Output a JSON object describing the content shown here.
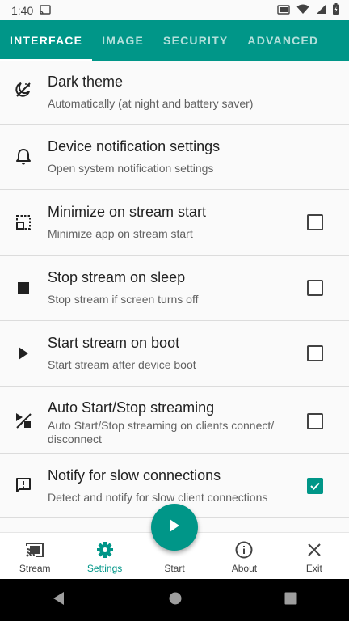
{
  "status_bar": {
    "time": "1:40",
    "icons": [
      "cast-icon",
      "wifi-icon",
      "signal-icon",
      "battery-icon"
    ]
  },
  "tabs": [
    {
      "label": "INTERFACE",
      "active": true
    },
    {
      "label": "IMAGE",
      "active": false
    },
    {
      "label": "SECURITY",
      "active": false
    },
    {
      "label": "ADVANCED",
      "active": false
    }
  ],
  "settings": [
    {
      "title": "Dark theme",
      "subtitle": "Automatically (at night and battery saver)",
      "icon": "dark-theme-icon",
      "has_checkbox": false
    },
    {
      "title": "Device notification settings",
      "subtitle": "Open system notification settings",
      "icon": "bell-icon",
      "has_checkbox": false
    },
    {
      "title": "Minimize on stream start",
      "subtitle": "Minimize app on stream start",
      "icon": "minimize-icon",
      "has_checkbox": true,
      "checked": false
    },
    {
      "title": "Stop stream on sleep",
      "subtitle": "Stop stream if screen turns off",
      "icon": "stop-icon",
      "has_checkbox": true,
      "checked": false
    },
    {
      "title": "Start stream on boot",
      "subtitle": "Start stream after device boot",
      "icon": "play-icon",
      "has_checkbox": true,
      "checked": false
    },
    {
      "title": "Auto Start/Stop streaming",
      "subtitle": "Auto Start/Stop streaming on clients connect/ disconnect",
      "icon": "auto-start-stop-icon",
      "has_checkbox": true,
      "checked": false
    },
    {
      "title": "Notify for slow connections",
      "subtitle": "Detect and notify for slow client connections",
      "icon": "alert-message-icon",
      "has_checkbox": true,
      "checked": true
    }
  ],
  "bottom_nav": [
    {
      "label": "Stream",
      "icon": "cast-icon",
      "active": false
    },
    {
      "label": "Settings",
      "icon": "gear-icon",
      "active": true
    },
    {
      "label": "Start",
      "icon": "",
      "active": false
    },
    {
      "label": "About",
      "icon": "info-icon",
      "active": false
    },
    {
      "label": "Exit",
      "icon": "close-icon",
      "active": false
    }
  ],
  "colors": {
    "accent": "#009688",
    "background": "#fafafa",
    "text": "#212121",
    "subtext": "#616161"
  }
}
